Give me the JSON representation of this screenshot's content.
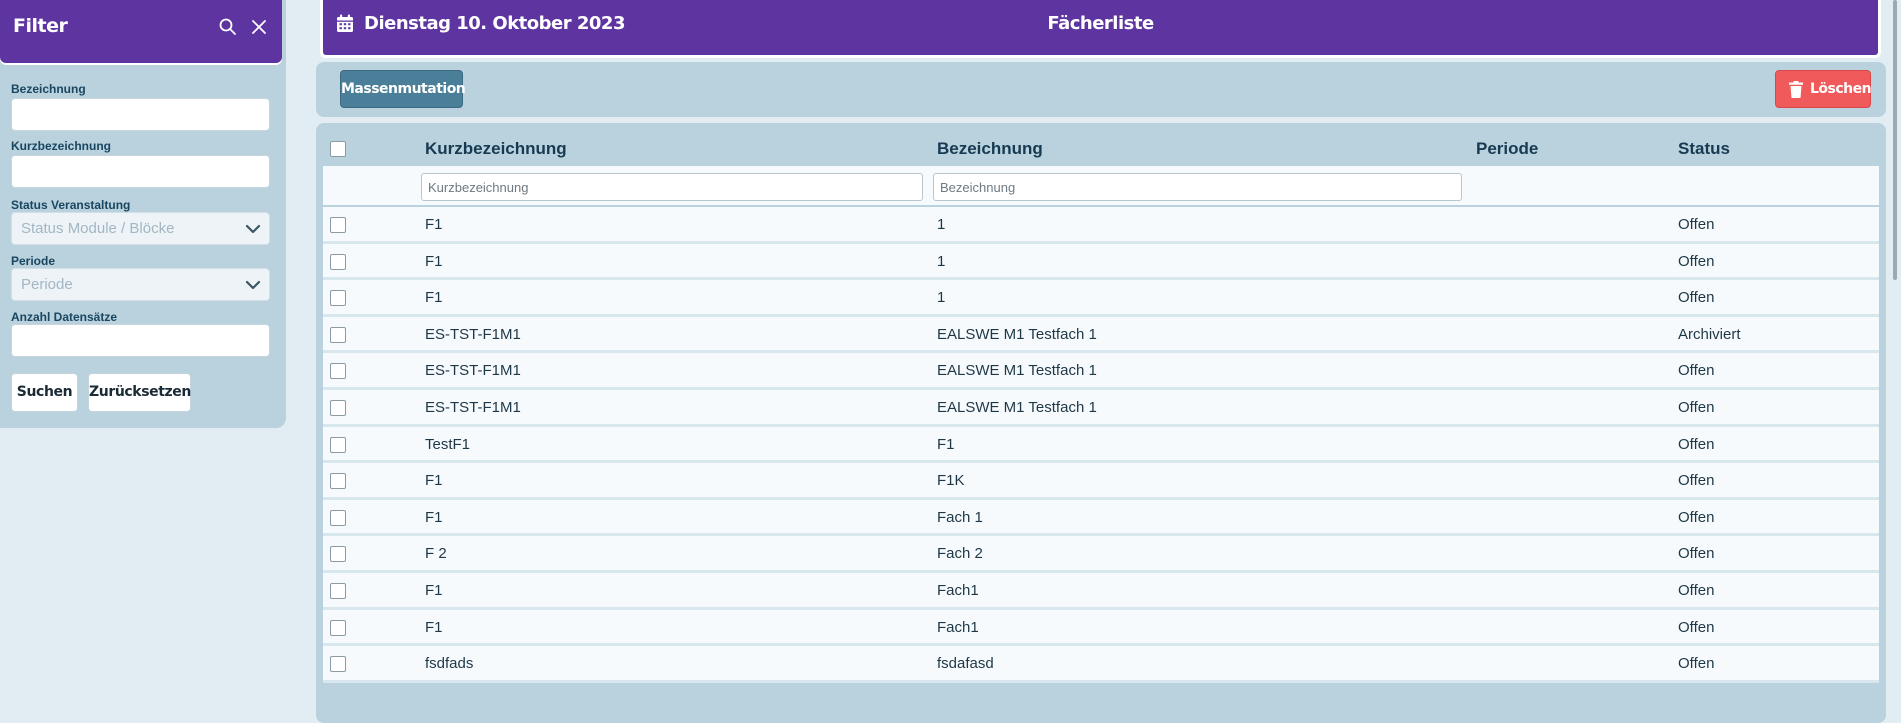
{
  "filter": {
    "title": "Filter",
    "fields": {
      "bezeichnung_label": "Bezeichnung",
      "kurzbezeichnung_label": "Kurzbezeichnung",
      "status_label": "Status Veranstaltung",
      "status_placeholder": "Status Module / Blöcke",
      "periode_label": "Periode",
      "periode_placeholder": "Periode",
      "anzahl_label": "Anzahl Datensätze"
    },
    "search_button": "Suchen",
    "reset_button": "Zurücksetzen",
    "icons": [
      "search-icon",
      "close-icon"
    ]
  },
  "header": {
    "date": "Dienstag 10. Oktober 2023",
    "title": "Fächerliste"
  },
  "toolbar": {
    "mass_mutation": "Massenmutation",
    "delete": "Löschen"
  },
  "table": {
    "columns": [
      "Kurzbezeichnung",
      "Bezeichnung",
      "Periode",
      "Status"
    ],
    "filter_placeholders": {
      "kurzbezeichnung": "Kurzbezeichnung",
      "bezeichnung": "Bezeichnung"
    },
    "rows": [
      {
        "kurz": "F1",
        "bez": "1",
        "periode": "",
        "status": "Offen"
      },
      {
        "kurz": "F1",
        "bez": "1",
        "periode": "",
        "status": "Offen"
      },
      {
        "kurz": "F1",
        "bez": "1",
        "periode": "",
        "status": "Offen"
      },
      {
        "kurz": "ES-TST-F1M1",
        "bez": "EALSWE M1 Testfach 1",
        "periode": "",
        "status": "Archiviert"
      },
      {
        "kurz": "ES-TST-F1M1",
        "bez": "EALSWE M1 Testfach 1",
        "periode": "",
        "status": "Offen"
      },
      {
        "kurz": "ES-TST-F1M1",
        "bez": "EALSWE M1 Testfach 1",
        "periode": "",
        "status": "Offen"
      },
      {
        "kurz": "TestF1",
        "bez": "F1",
        "periode": "",
        "status": "Offen"
      },
      {
        "kurz": "F1",
        "bez": "F1K",
        "periode": "",
        "status": "Offen"
      },
      {
        "kurz": "F1",
        "bez": "Fach 1",
        "periode": "",
        "status": "Offen"
      },
      {
        "kurz": "F 2",
        "bez": "Fach 2",
        "periode": "",
        "status": "Offen"
      },
      {
        "kurz": "F1",
        "bez": "Fach1",
        "periode": "",
        "status": "Offen"
      },
      {
        "kurz": "F1",
        "bez": "Fach1",
        "periode": "",
        "status": "Offen"
      },
      {
        "kurz": "fsdfads",
        "bez": "fsdafasd",
        "periode": "",
        "status": "Offen"
      }
    ]
  },
  "colors": {
    "brand_purple": "#5e35a0",
    "panel_blue": "#b9d2de",
    "button_blue": "#4b7f99",
    "delete_red": "#f05a5a",
    "background": "#e1edf3"
  }
}
